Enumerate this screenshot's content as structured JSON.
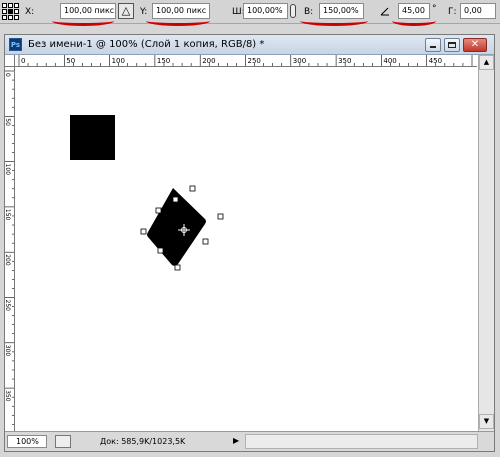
{
  "options_bar": {
    "x_label": "X:",
    "x_value": "100,00 пикс",
    "y_label": "Y:",
    "y_value": "100,00 пикс",
    "w_label": "Ш:",
    "w_value": "100,00%",
    "h_label": "В:",
    "h_value": "150,00%",
    "angle_value": "45,00",
    "degree_sign": "°",
    "skew_label": "Г:",
    "skew_value": "0,00"
  },
  "document": {
    "app_icon_text": "Ps",
    "title": "Без имени-1 @ 100% (Слой 1 копия, RGB/8) *"
  },
  "rulers": {
    "h_ticks": [
      "0",
      "50",
      "100",
      "150",
      "200",
      "250",
      "300",
      "350",
      "400",
      "450"
    ],
    "v_ticks": [
      "0",
      "50",
      "100",
      "150",
      "200",
      "250",
      "300",
      "350"
    ]
  },
  "status_bar": {
    "zoom": "100%",
    "doc_info": "Док: 585,9K/1023,5K",
    "arrow": "▶"
  },
  "colors": {
    "annotation": "#cc0000",
    "shape": "#000000",
    "titlebar": "#c8d4e4"
  }
}
